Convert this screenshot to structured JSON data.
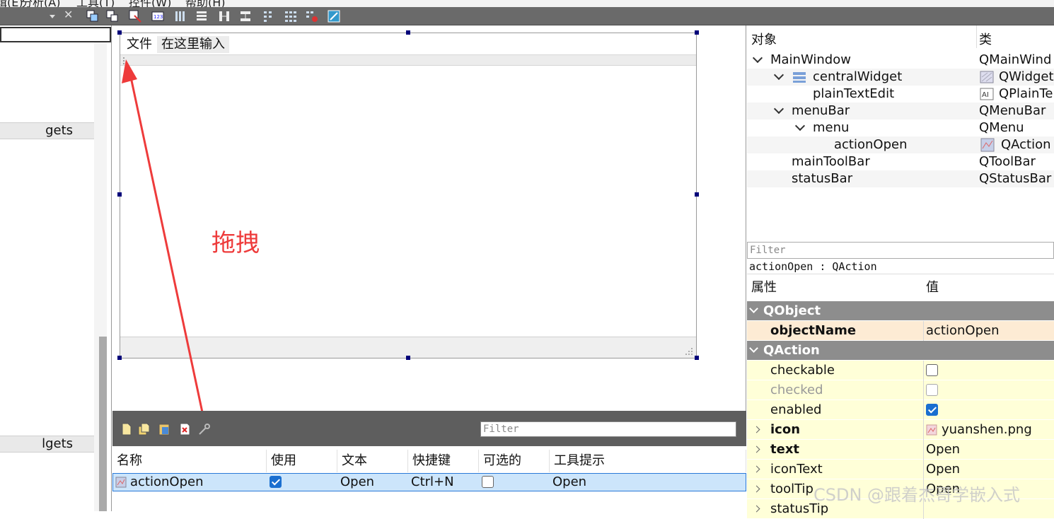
{
  "menubar": {
    "items": [
      "辑(E)",
      "分析(A)",
      "工具(T)",
      "控件(W)",
      "帮助(H)"
    ]
  },
  "left_panel": {
    "sections": [
      "gets",
      "lgets"
    ]
  },
  "form": {
    "menu_items": [
      "文件",
      "在这里输入"
    ],
    "annotation": "拖拽"
  },
  "action_editor": {
    "filter_placeholder": "Filter",
    "columns": [
      "名称",
      "使用",
      "文本",
      "快捷键",
      "可选的",
      "工具提示"
    ],
    "row": {
      "name": "actionOpen",
      "used": true,
      "text": "Open",
      "shortcut": "Ctrl+N",
      "checkable": false,
      "tooltip": "Open"
    }
  },
  "object_inspector": {
    "col_object": "对象",
    "col_class": "类",
    "rows": [
      {
        "name": "MainWindow",
        "class": "QMainWind"
      },
      {
        "name": "centralWidget",
        "class": "QWidget"
      },
      {
        "name": "plainTextEdit",
        "class": "QPlainTe"
      },
      {
        "name": "menuBar",
        "class": "QMenuBar"
      },
      {
        "name": "menu",
        "class": "QMenu"
      },
      {
        "name": "actionOpen",
        "class": "QAction"
      },
      {
        "name": "mainToolBar",
        "class": "QToolBar"
      },
      {
        "name": "statusBar",
        "class": "QStatusBar"
      }
    ]
  },
  "property_editor": {
    "filter_placeholder": "Filter",
    "title": "actionOpen : QAction",
    "col_property": "属性",
    "col_value": "值",
    "groups": [
      "QObject",
      "QAction"
    ],
    "object_name": {
      "name": "objectName",
      "value": "actionOpen"
    },
    "props": [
      {
        "name": "checkable",
        "value": ""
      },
      {
        "name": "checked",
        "value": ""
      },
      {
        "name": "enabled",
        "value": ""
      },
      {
        "name": "icon",
        "value": "yuanshen.png"
      },
      {
        "name": "text",
        "value": "Open"
      },
      {
        "name": "iconText",
        "value": "Open"
      },
      {
        "name": "toolTip",
        "value": "Open"
      },
      {
        "name": "statusTip",
        "value": ""
      }
    ],
    "checkable": false,
    "checked": false,
    "enabled": true
  },
  "watermark": "CSDN @跟着杰哥学嵌入式",
  "colors": {
    "group_header": "#8d8d8d",
    "property_row": "#ffffd8",
    "selection": "#cce5fb",
    "annotation": "#ee3b3b"
  }
}
